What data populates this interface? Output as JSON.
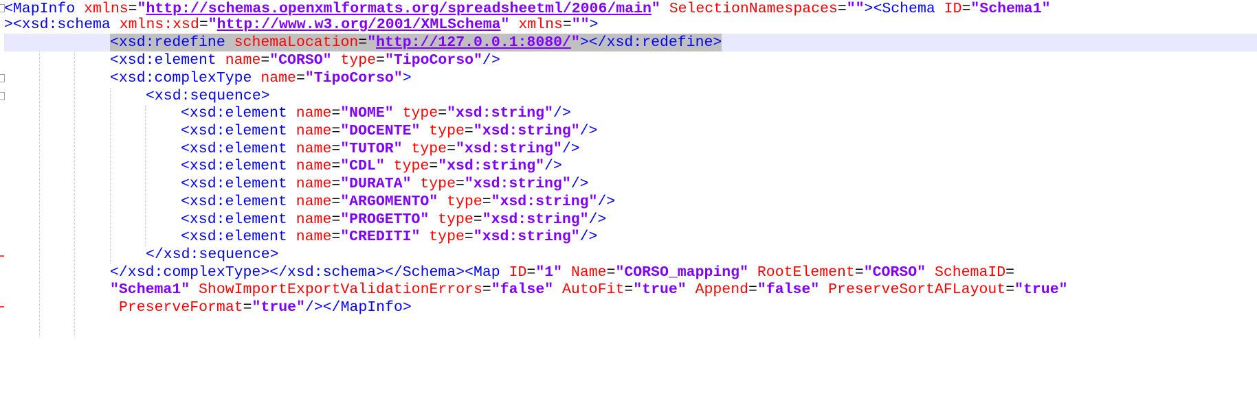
{
  "editor": {
    "lines": [
      {
        "segments": [
          {
            "t": "<MapInfo ",
            "c": "tag"
          },
          {
            "t": "xmlns",
            "c": "attr"
          },
          {
            "t": "=",
            "c": "eq"
          },
          {
            "t": "\"",
            "c": "val"
          },
          {
            "t": "http://schemas.openxmlformats.org/spreadsheetml/2006/main",
            "c": "url"
          },
          {
            "t": "\" ",
            "c": "val"
          },
          {
            "t": "SelectionNamespaces",
            "c": "attr"
          },
          {
            "t": "=",
            "c": "eq"
          },
          {
            "t": "\"\"",
            "c": "val"
          },
          {
            "t": "><Schema ",
            "c": "tag"
          },
          {
            "t": "ID",
            "c": "attr"
          },
          {
            "t": "=",
            "c": "eq"
          },
          {
            "t": "\"Schema1\"",
            "c": "val"
          }
        ]
      },
      {
        "segments": [
          {
            "t": "><xsd:schema ",
            "c": "tag"
          },
          {
            "t": "xmlns:xsd",
            "c": "attr"
          },
          {
            "t": "=",
            "c": "eq"
          },
          {
            "t": "\"",
            "c": "val"
          },
          {
            "t": "http://www.w3.org/2001/XMLSchema",
            "c": "url"
          },
          {
            "t": "\" ",
            "c": "val"
          },
          {
            "t": "xmlns",
            "c": "attr"
          },
          {
            "t": "=",
            "c": "eq"
          },
          {
            "t": "\"\"",
            "c": "val"
          },
          {
            "t": ">",
            "c": "tag"
          }
        ]
      },
      {
        "segments": [
          {
            "t": "<xsd:redefine ",
            "c": "tag"
          },
          {
            "t": "schemaLocation",
            "c": "attr"
          },
          {
            "t": "=",
            "c": "eq"
          },
          {
            "t": "\"",
            "c": "val"
          },
          {
            "t": "http://127.0.0.1:8080/",
            "c": "url"
          },
          {
            "t": "\"",
            "c": "val"
          },
          {
            "t": "></xsd:redefine>",
            "c": "tag"
          }
        ]
      },
      {
        "segments": [
          {
            "t": "<xsd:element ",
            "c": "tag"
          },
          {
            "t": "name",
            "c": "attr"
          },
          {
            "t": "=",
            "c": "eq"
          },
          {
            "t": "\"CORSO\" ",
            "c": "val"
          },
          {
            "t": "type",
            "c": "attr"
          },
          {
            "t": "=",
            "c": "eq"
          },
          {
            "t": "\"TipoCorso\"",
            "c": "val"
          },
          {
            "t": "/>",
            "c": "tag"
          }
        ]
      },
      {
        "segments": [
          {
            "t": "<xsd:complexType ",
            "c": "tag"
          },
          {
            "t": "name",
            "c": "attr"
          },
          {
            "t": "=",
            "c": "eq"
          },
          {
            "t": "\"TipoCorso\"",
            "c": "val"
          },
          {
            "t": ">",
            "c": "tag"
          }
        ]
      },
      {
        "segments": [
          {
            "t": "<xsd:sequence>",
            "c": "tag"
          }
        ]
      },
      {
        "segments": [
          {
            "t": "<xsd:element ",
            "c": "tag"
          },
          {
            "t": "name",
            "c": "attr"
          },
          {
            "t": "=",
            "c": "eq"
          },
          {
            "t": "\"NOME\" ",
            "c": "val"
          },
          {
            "t": "type",
            "c": "attr"
          },
          {
            "t": "=",
            "c": "eq"
          },
          {
            "t": "\"xsd:string\"",
            "c": "val"
          },
          {
            "t": "/>",
            "c": "tag"
          }
        ]
      },
      {
        "segments": [
          {
            "t": "<xsd:element ",
            "c": "tag"
          },
          {
            "t": "name",
            "c": "attr"
          },
          {
            "t": "=",
            "c": "eq"
          },
          {
            "t": "\"DOCENTE\" ",
            "c": "val"
          },
          {
            "t": "type",
            "c": "attr"
          },
          {
            "t": "=",
            "c": "eq"
          },
          {
            "t": "\"xsd:string\"",
            "c": "val"
          },
          {
            "t": "/>",
            "c": "tag"
          }
        ]
      },
      {
        "segments": [
          {
            "t": "<xsd:element ",
            "c": "tag"
          },
          {
            "t": "name",
            "c": "attr"
          },
          {
            "t": "=",
            "c": "eq"
          },
          {
            "t": "\"TUTOR\" ",
            "c": "val"
          },
          {
            "t": "type",
            "c": "attr"
          },
          {
            "t": "=",
            "c": "eq"
          },
          {
            "t": "\"xsd:string\"",
            "c": "val"
          },
          {
            "t": "/>",
            "c": "tag"
          }
        ]
      },
      {
        "segments": [
          {
            "t": "<xsd:element ",
            "c": "tag"
          },
          {
            "t": "name",
            "c": "attr"
          },
          {
            "t": "=",
            "c": "eq"
          },
          {
            "t": "\"CDL\" ",
            "c": "val"
          },
          {
            "t": "type",
            "c": "attr"
          },
          {
            "t": "=",
            "c": "eq"
          },
          {
            "t": "\"xsd:string\"",
            "c": "val"
          },
          {
            "t": "/>",
            "c": "tag"
          }
        ]
      },
      {
        "segments": [
          {
            "t": "<xsd:element ",
            "c": "tag"
          },
          {
            "t": "name",
            "c": "attr"
          },
          {
            "t": "=",
            "c": "eq"
          },
          {
            "t": "\"DURATA\" ",
            "c": "val"
          },
          {
            "t": "type",
            "c": "attr"
          },
          {
            "t": "=",
            "c": "eq"
          },
          {
            "t": "\"xsd:string\"",
            "c": "val"
          },
          {
            "t": "/>",
            "c": "tag"
          }
        ]
      },
      {
        "segments": [
          {
            "t": "<xsd:element ",
            "c": "tag"
          },
          {
            "t": "name",
            "c": "attr"
          },
          {
            "t": "=",
            "c": "eq"
          },
          {
            "t": "\"ARGOMENTO\" ",
            "c": "val"
          },
          {
            "t": "type",
            "c": "attr"
          },
          {
            "t": "=",
            "c": "eq"
          },
          {
            "t": "\"xsd:string\"",
            "c": "val"
          },
          {
            "t": "/>",
            "c": "tag"
          }
        ]
      },
      {
        "segments": [
          {
            "t": "<xsd:element ",
            "c": "tag"
          },
          {
            "t": "name",
            "c": "attr"
          },
          {
            "t": "=",
            "c": "eq"
          },
          {
            "t": "\"PROGETTO\" ",
            "c": "val"
          },
          {
            "t": "type",
            "c": "attr"
          },
          {
            "t": "=",
            "c": "eq"
          },
          {
            "t": "\"xsd:string\"",
            "c": "val"
          },
          {
            "t": "/>",
            "c": "tag"
          }
        ]
      },
      {
        "segments": [
          {
            "t": "<xsd:element ",
            "c": "tag"
          },
          {
            "t": "name",
            "c": "attr"
          },
          {
            "t": "=",
            "c": "eq"
          },
          {
            "t": "\"CREDITI\" ",
            "c": "val"
          },
          {
            "t": "type",
            "c": "attr"
          },
          {
            "t": "=",
            "c": "eq"
          },
          {
            "t": "\"xsd:string\"",
            "c": "val"
          },
          {
            "t": "/>",
            "c": "tag"
          }
        ]
      },
      {
        "segments": [
          {
            "t": "</xsd:sequence>",
            "c": "tag"
          }
        ]
      },
      {
        "segments": [
          {
            "t": "</xsd:complexType></xsd:schema></Schema><Map ",
            "c": "tag"
          },
          {
            "t": "ID",
            "c": "attr"
          },
          {
            "t": "=",
            "c": "eq"
          },
          {
            "t": "\"1\" ",
            "c": "val"
          },
          {
            "t": "Name",
            "c": "attr"
          },
          {
            "t": "=",
            "c": "eq"
          },
          {
            "t": "\"CORSO_mapping\" ",
            "c": "val"
          },
          {
            "t": "RootElement",
            "c": "attr"
          },
          {
            "t": "=",
            "c": "eq"
          },
          {
            "t": "\"CORSO\" ",
            "c": "val"
          },
          {
            "t": "SchemaID",
            "c": "attr"
          },
          {
            "t": "=",
            "c": "eq"
          }
        ]
      },
      {
        "segments": [
          {
            "t": "\"Schema1\" ",
            "c": "val"
          },
          {
            "t": "ShowImportExportValidationErrors",
            "c": "attr"
          },
          {
            "t": "=",
            "c": "eq"
          },
          {
            "t": "\"false\" ",
            "c": "val"
          },
          {
            "t": "AutoFit",
            "c": "attr"
          },
          {
            "t": "=",
            "c": "eq"
          },
          {
            "t": "\"true\" ",
            "c": "val"
          },
          {
            "t": "Append",
            "c": "attr"
          },
          {
            "t": "=",
            "c": "eq"
          },
          {
            "t": "\"false\" ",
            "c": "val"
          },
          {
            "t": "PreserveSortAFLayout",
            "c": "attr"
          },
          {
            "t": "=",
            "c": "eq"
          },
          {
            "t": "\"true\"",
            "c": "val"
          }
        ]
      },
      {
        "segments": [
          {
            "t": "PreserveFormat",
            "c": "attr"
          },
          {
            "t": "=",
            "c": "eq"
          },
          {
            "t": "\"true\"",
            "c": "val"
          },
          {
            "t": "/></MapInfo>",
            "c": "tag"
          }
        ]
      }
    ]
  },
  "colors": {
    "tag": "#0000ff",
    "attribute": "#ff0000",
    "value": "#8000ff",
    "current_line": "#e8e8ff",
    "selection": "#c0c0c0"
  }
}
